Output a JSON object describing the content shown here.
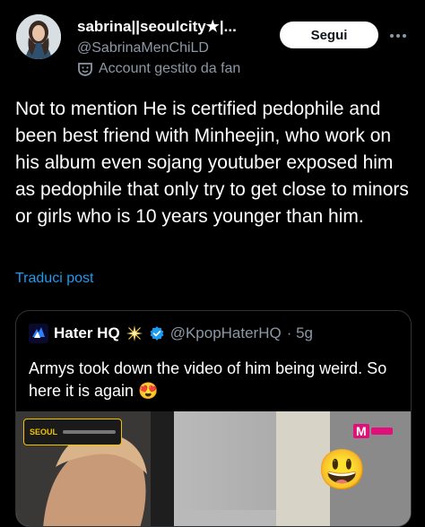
{
  "tweet": {
    "display_name": "sabrina||seoulcity★|...",
    "handle": "@SabrinaMenChiLD",
    "fan_label": "Account gestito da fan",
    "follow_label": "Segui",
    "text": "Not to mention He is certified pedophile and been best friend with Minheejin, who work on his album even sojang youtuber exposed him as pedophile that only try to get close to minors or girls who is 10 years younger than him.",
    "translate_label": "Traduci post"
  },
  "quote": {
    "name": "Hater HQ",
    "handle": "@KpopHaterHQ",
    "time": "· 5g",
    "text": "Armys took down the video of him being weird. So here it is again",
    "text_emoji": "😍"
  },
  "media": {
    "overlay_text": "SEOUL",
    "logo_text": "M",
    "emoji": "😃"
  },
  "colors": {
    "accent": "#1d9bf0",
    "verified": "#1d9bf0",
    "muted": "#8b98a5"
  }
}
